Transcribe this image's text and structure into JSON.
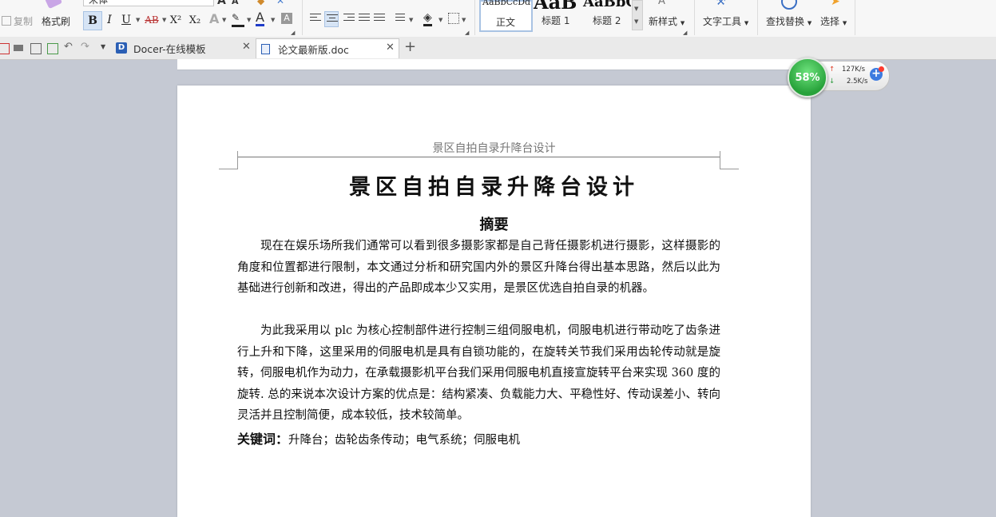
{
  "ribbon": {
    "copy_label": "复制",
    "format_painter_label": "格式刷",
    "font_name": "宋体",
    "bold": "B",
    "italic": "I",
    "underline": "U",
    "strike": "AB",
    "superscript": "X²",
    "subscript": "X₂",
    "font_color": "A",
    "styles": [
      {
        "preview": "AaBbCcDd",
        "label": "正文"
      },
      {
        "preview": "AaB",
        "label": "标题 1"
      },
      {
        "preview": "AaBbC",
        "label": "标题 2"
      }
    ],
    "new_style_label": "新样式",
    "text_tools_label": "文字工具",
    "find_replace_label": "查找替换",
    "select_label": "选择"
  },
  "tabs": [
    {
      "label": "Docer-在线模板"
    },
    {
      "label": "论文最新版.doc"
    }
  ],
  "document": {
    "header": "景区自拍自录升降台设计",
    "title": "景区自拍自录升降台设计",
    "abstract_heading": "摘要",
    "paragraphs": [
      "现在在娱乐场所我们通常可以看到很多摄影家都是自己背任摄影机进行摄影，这样摄影的角度和位置都进行限制，本文通过分析和研究国内外的景区升降台得出基本思路，然后以此为基础进行创新和改进，得出的产品即成本少又实用，是景区优选自拍自录的机器。",
      "为此我采用以 plc 为核心控制部件进行控制三组伺服电机，伺服电机进行带动吃了齿条进行上升和下降，这里采用的伺服电机是具有自锁功能的，在旋转关节我们采用齿轮传动就是旋转，伺服电机作为动力，在承载摄影机平台我们采用伺服电机直接宣旋转平台来实现 360 度的旋转. 总的来说本次设计方案的优点是：结构紧凑、负载能力大、平稳性好、传动误差小、转向灵活并且控制简便，成本较低，技术较简单。"
    ],
    "keywords_label": "关键词：",
    "keywords": "升降台；齿轮齿条传动；电气系统；伺服电机"
  },
  "net_monitor": {
    "percent": "58%",
    "up_speed": "127K/s",
    "down_speed": "2.5K/s"
  },
  "colors": {
    "net_green": "#27a23a",
    "tab_doc_icon": "#2b5fb5"
  }
}
